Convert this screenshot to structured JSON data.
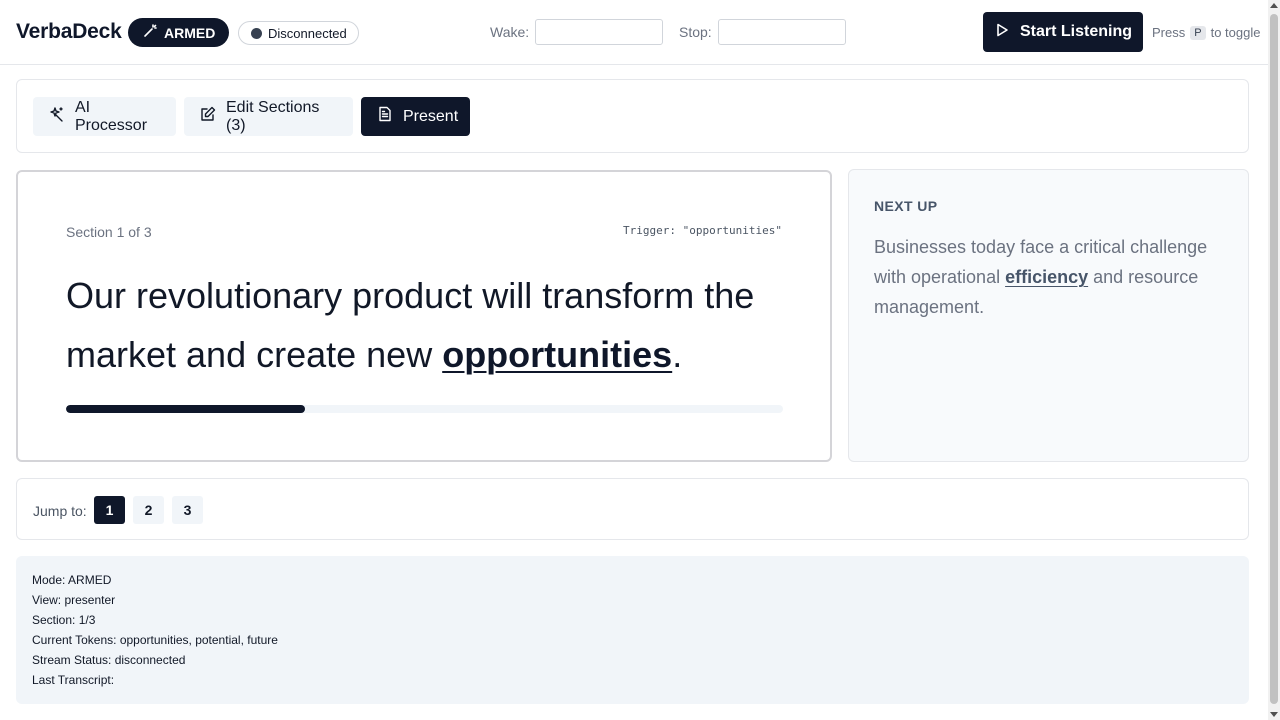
{
  "header": {
    "brand": "VerbaDeck",
    "armed_label": "ARMED",
    "connection_label": "Disconnected",
    "wake_label": "Wake:",
    "wake_value": "",
    "stop_label": "Stop:",
    "stop_value": "",
    "start_label": "Start Listening",
    "hint_prefix": "Press",
    "hint_key": "P",
    "hint_suffix": "to toggle"
  },
  "tabs": [
    {
      "label": "AI Processor",
      "icon": "sparkles-icon",
      "active": false
    },
    {
      "label": "Edit Sections (3)",
      "icon": "edit-icon",
      "active": false
    },
    {
      "label": "Present",
      "icon": "document-icon",
      "active": true
    }
  ],
  "presenter": {
    "section_label": "Section 1 of 3",
    "trigger_label": "Trigger: \"opportunities\"",
    "text_before": "Our revolutionary product will transform the market and create new ",
    "keyword": "opportunities",
    "text_after": ".",
    "progress_fraction": 0.333
  },
  "next_up": {
    "title": "NEXT UP",
    "text_before": "Businesses today face a critical challenge with operational ",
    "keyword": "efficiency",
    "text_after": " and resource management."
  },
  "jump": {
    "label": "Jump to:",
    "pages": [
      "1",
      "2",
      "3"
    ],
    "active_page": "1"
  },
  "debug": {
    "lines": [
      "Mode: ARMED",
      "View: presenter",
      "Section: 1/3",
      "Current Tokens: opportunities, potential, future",
      "Stream Status: disconnected",
      "Last Transcript:"
    ]
  },
  "colors": {
    "primary": "#0f172a",
    "muted_bg": "#f1f5f9",
    "border": "#e5e7eb"
  }
}
